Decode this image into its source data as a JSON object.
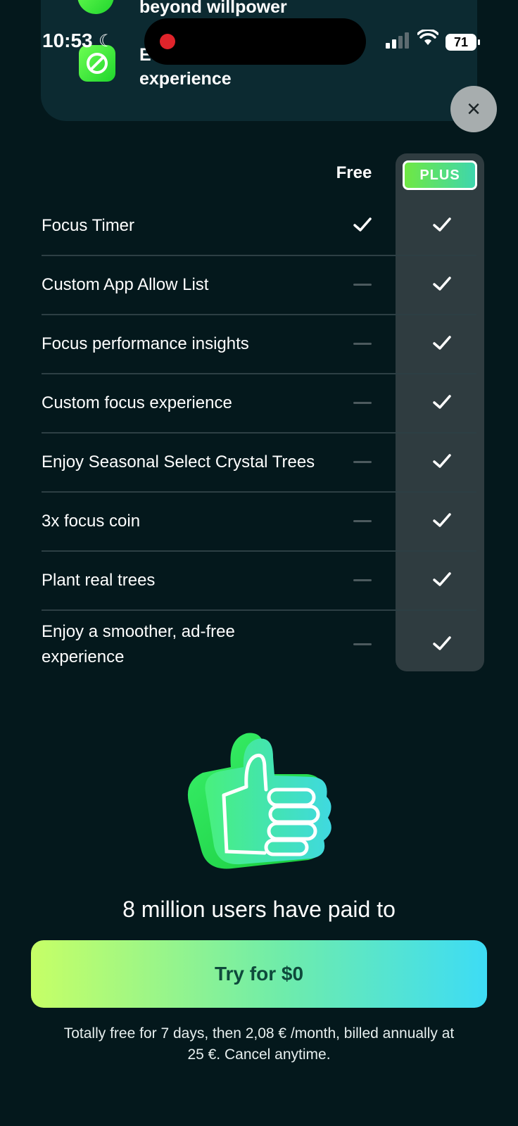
{
  "top_card": {
    "feature_1": "beyond willpower",
    "feature_2_prefix": "E",
    "feature_2": "experience"
  },
  "status_bar": {
    "time": "10:53",
    "battery": "71"
  },
  "close_label": "×",
  "table": {
    "free_header": "Free",
    "plus_header": "PLUS",
    "rows": [
      {
        "label": "Focus Timer",
        "free": true,
        "plus": true
      },
      {
        "label": "Custom App Allow List",
        "free": false,
        "plus": true
      },
      {
        "label": "Focus performance insights",
        "free": false,
        "plus": true
      },
      {
        "label": "Custom focus experience",
        "free": false,
        "plus": true
      },
      {
        "label": "Enjoy Seasonal Select Crystal Trees",
        "free": false,
        "plus": true
      },
      {
        "label": "3x focus coin",
        "free": false,
        "plus": true
      },
      {
        "label": "Plant real trees",
        "free": false,
        "plus": true
      },
      {
        "label": "Enjoy a smoother, ad-free experience",
        "free": false,
        "plus": true
      }
    ]
  },
  "social_proof": "8 million users have paid to",
  "cta": {
    "label": "Try for $0"
  },
  "terms": "Totally free for 7 days, then 2,08 € /month, billed annually at 25 €. Cancel anytime.",
  "colors": {
    "background": "#04181c",
    "plus_column": "#2f3c40",
    "accent_green": "#6fe843",
    "accent_cyan": "#3ddcf5"
  }
}
